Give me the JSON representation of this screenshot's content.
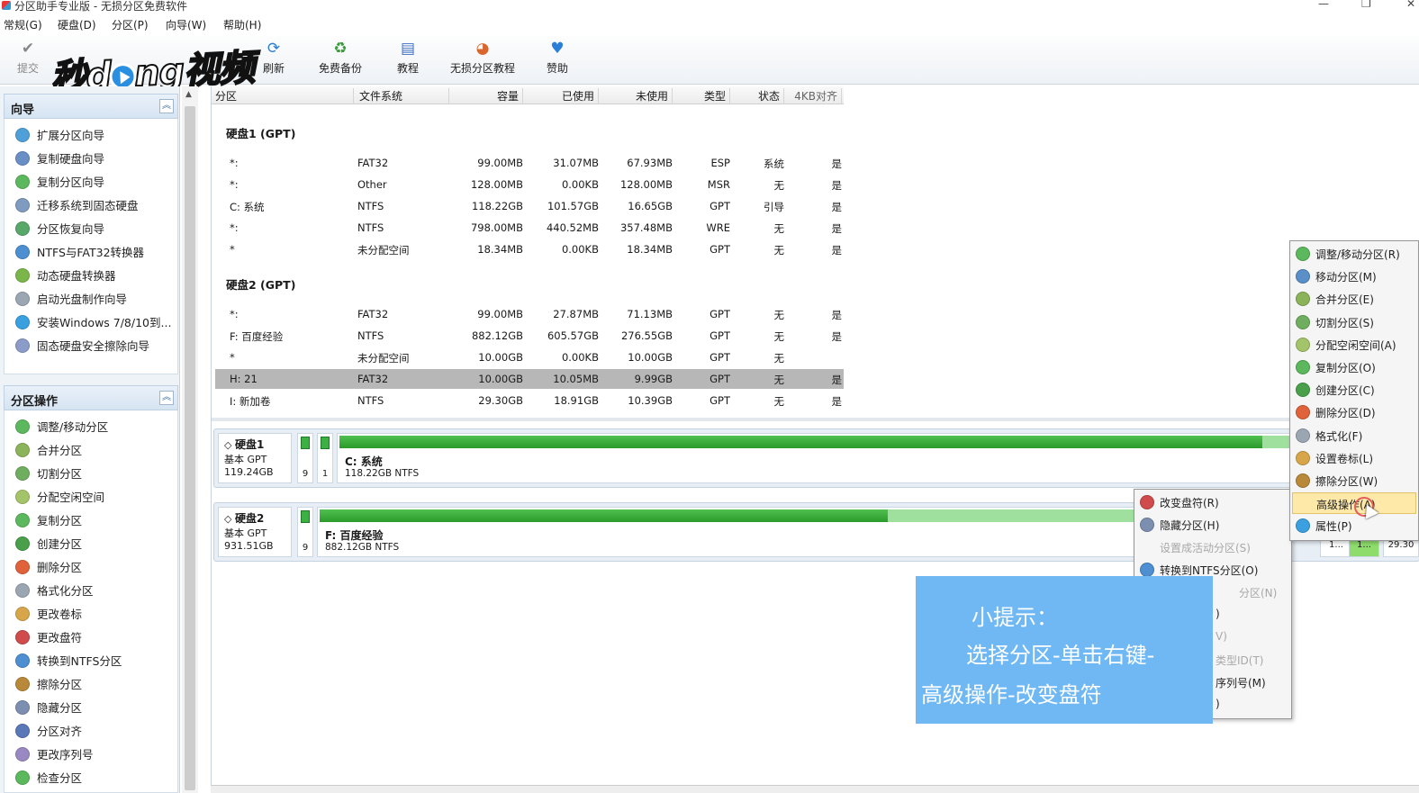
{
  "window": {
    "title": "分区助手专业版 - 无损分区免费软件",
    "min": "—",
    "max": "❐",
    "close": "✕"
  },
  "menu": [
    "常规(G)",
    "硬盘(D)",
    "分区(P)",
    "向导(W)",
    "帮助(H)"
  ],
  "toolbar": {
    "commit": "提交",
    "refresh": "刷新",
    "backup": "免费备份",
    "tutorial": "教程",
    "lossless": "无损分区教程",
    "sponsor": "赞助"
  },
  "watermark": {
    "text_a": "秒d",
    "text_b": "ng视频"
  },
  "wizard": {
    "title": "向导",
    "items": [
      "扩展分区向导",
      "复制硬盘向导",
      "复制分区向导",
      "迁移系统到固态硬盘",
      "分区恢复向导",
      "NTFS与FAT32转换器",
      "动态硬盘转换器",
      "启动光盘制作向导",
      "安装Windows 7/8/10到...",
      "固态硬盘安全擦除向导"
    ]
  },
  "partops": {
    "title": "分区操作",
    "items": [
      "调整/移动分区",
      "合并分区",
      "切割分区",
      "分配空闲空间",
      "复制分区",
      "创建分区",
      "删除分区",
      "格式化分区",
      "更改卷标",
      "更改盘符",
      "转换到NTFS分区",
      "擦除分区",
      "隐藏分区",
      "分区对齐",
      "更改序列号",
      "检查分区"
    ]
  },
  "columns": [
    "分区",
    "文件系统",
    "容量",
    "已使用",
    "未使用",
    "类型",
    "状态",
    "4KB对齐"
  ],
  "disks": [
    {
      "title": "硬盘1 (GPT)",
      "rows": [
        [
          "*:",
          "FAT32",
          "99.00MB",
          "31.07MB",
          "67.93MB",
          "ESP",
          "系统",
          "是"
        ],
        [
          "*:",
          "Other",
          "128.00MB",
          "0.00KB",
          "128.00MB",
          "MSR",
          "无",
          "是"
        ],
        [
          "C: 系统",
          "NTFS",
          "118.22GB",
          "101.57GB",
          "16.65GB",
          "GPT",
          "引导",
          "是"
        ],
        [
          "*:",
          "NTFS",
          "798.00MB",
          "440.52MB",
          "357.48MB",
          "WRE",
          "无",
          "是"
        ],
        [
          "*",
          "未分配空间",
          "18.34MB",
          "0.00KB",
          "18.34MB",
          "GPT",
          "无",
          "是"
        ]
      ]
    },
    {
      "title": "硬盘2 (GPT)",
      "rows": [
        [
          "*:",
          "FAT32",
          "99.00MB",
          "27.87MB",
          "71.13MB",
          "GPT",
          "无",
          "是"
        ],
        [
          "F: 百度经验",
          "NTFS",
          "882.12GB",
          "605.57GB",
          "276.55GB",
          "GPT",
          "无",
          "是"
        ],
        [
          "*",
          "未分配空间",
          "10.00GB",
          "0.00KB",
          "10.00GB",
          "GPT",
          "无",
          ""
        ],
        [
          "H: 21",
          "FAT32",
          "10.00GB",
          "10.05MB",
          "9.99GB",
          "GPT",
          "无",
          "是"
        ],
        [
          "I: 新加卷",
          "NTFS",
          "29.30GB",
          "18.91GB",
          "10.39GB",
          "GPT",
          "无",
          "是"
        ]
      ]
    }
  ],
  "diskmap": [
    {
      "name": "硬盘1",
      "type": "基本 GPT",
      "size": "119.24GB",
      "minis": [
        "9",
        "1"
      ],
      "part_name": "C: 系统",
      "part_size": "118.22GB NTFS",
      "used_fraction": 0.86
    },
    {
      "name": "硬盘2",
      "type": "基本 GPT",
      "size": "931.51GB",
      "minis": [
        "9"
      ],
      "part_name": "F: 百度经验",
      "part_size": "882.12GB NTFS",
      "used_fraction": 0.69
    }
  ],
  "diskmap_tail": [
    "1...",
    "1...",
    "29.30"
  ],
  "context_main": [
    "调整/移动分区(R)",
    "移动分区(M)",
    "合并分区(E)",
    "切割分区(S)",
    "分配空闲空间(A)",
    "复制分区(O)",
    "创建分区(C)",
    "删除分区(D)",
    "格式化(F)",
    "设置卷标(L)",
    "擦除分区(W)",
    "高级操作(A)",
    "属性(P)"
  ],
  "context_sub": {
    "items": [
      "改变盘符(R)",
      "隐藏分区(H)",
      "设置成活动分区(S)",
      "转换到NTFS分区(O)"
    ],
    "hidden_tails": [
      "分区(N)",
      ")",
      "V)",
      "类型ID(T)",
      "序列号(M)",
      ")"
    ]
  },
  "tip": {
    "line1": "小提示：",
    "line2": "选择分区-单击右键-",
    "line3": "高级操作-改变盘符"
  },
  "colors": {
    "accent": "#3cb043",
    "tip": "#6fb8f4",
    "selected_row": "#b7b7b7"
  }
}
